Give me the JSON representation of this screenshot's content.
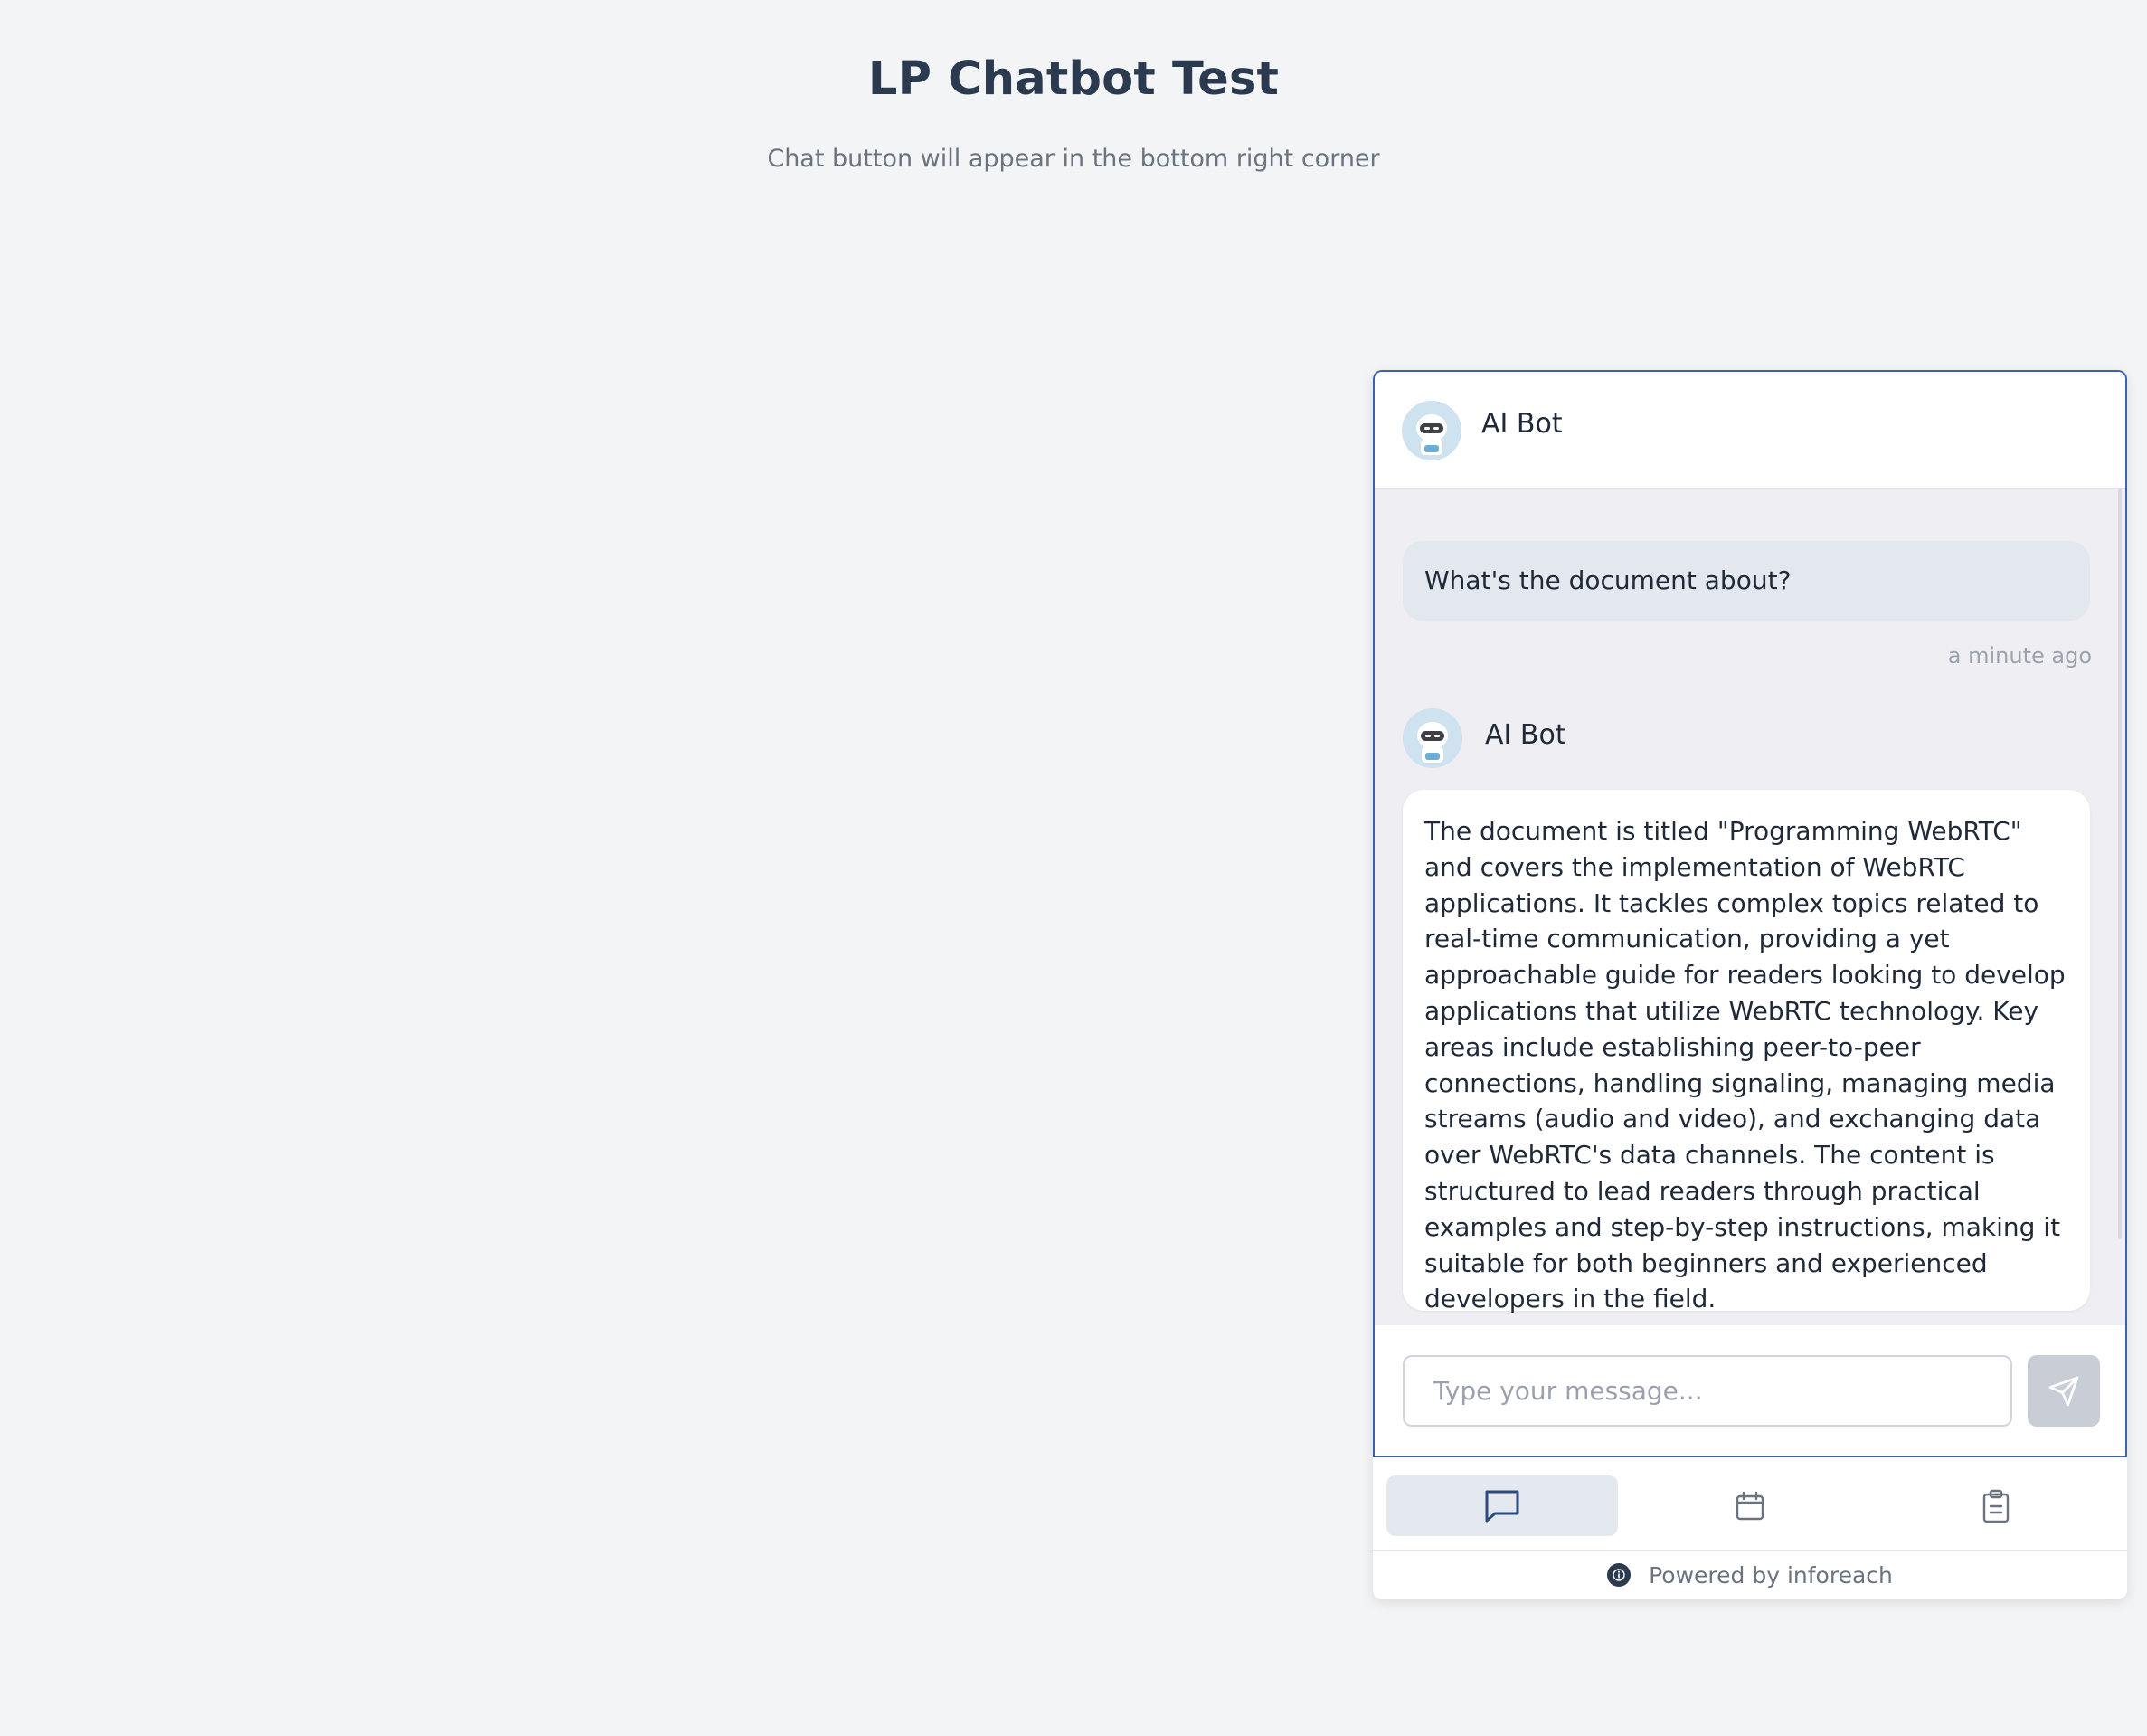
{
  "page": {
    "title": "LP Chatbot Test",
    "subtitle": "Chat button will appear in the bottom right corner"
  },
  "chat": {
    "header": {
      "bot_name": "AI Bot",
      "avatar_icon": "robot-avatar-icon"
    },
    "messages": [
      {
        "role": "user",
        "text": "What's the document about?",
        "time": "a minute ago"
      },
      {
        "role": "bot",
        "sender": "AI Bot",
        "text": "The document is titled \"Programming WebRTC\" and covers the implementation of WebRTC applications. It tackles complex topics related to real-time communication, providing a yet approachable guide for readers looking to develop applications that utilize WebRTC technology. Key areas include establishing peer-to-peer connections, handling signaling, managing media streams (audio and video), and exchanging data over WebRTC's data channels. The content is structured to lead readers through practical examples and step-by-step instructions, making it suitable for both beginners and experienced developers in the field."
      }
    ],
    "input": {
      "placeholder": "Type your message...",
      "value": ""
    },
    "send_icon": "send-icon"
  },
  "tabs": [
    {
      "name": "chat",
      "icon": "chat-bubble-icon",
      "active": true
    },
    {
      "name": "calendar",
      "icon": "calendar-icon",
      "active": false
    },
    {
      "name": "clipboard",
      "icon": "clipboard-icon",
      "active": false
    }
  ],
  "footer": {
    "powered_by": "Powered by inforeach"
  },
  "colors": {
    "accent_border": "#3d63ad",
    "page_background": "#f3f4f6",
    "chat_background": "#efeef2",
    "user_bubble": "#e3e8ef"
  }
}
